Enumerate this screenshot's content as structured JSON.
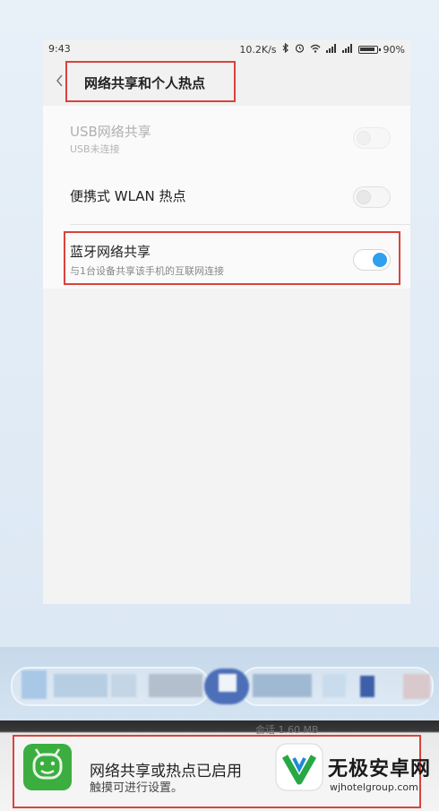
{
  "status_bar": {
    "time": "9:43",
    "net_speed": "10.2K/s",
    "battery": "90%"
  },
  "header": {
    "title": "网络共享和个人热点"
  },
  "settings": {
    "usb": {
      "label": "USB网络共享",
      "sub": "USB未连接",
      "state": "off",
      "enabled": false
    },
    "wlan": {
      "label": "便携式 WLAN 热点",
      "state": "off"
    },
    "bluetooth": {
      "label": "蓝牙网络共享",
      "sub": "与1台设备共享该手机的互联网连接",
      "state": "on"
    }
  },
  "notification": {
    "partial_top": "会话 1.60 MB",
    "title": "网络共享或热点已启用",
    "sub": "触摸可进行设置。"
  },
  "watermark": {
    "name": "无极安卓网",
    "url": "wjhotelgroup.com"
  },
  "colors": {
    "highlight": "#d9433c",
    "toggle_on": "#2f9ff0",
    "app_icon": "#3cae3f"
  }
}
